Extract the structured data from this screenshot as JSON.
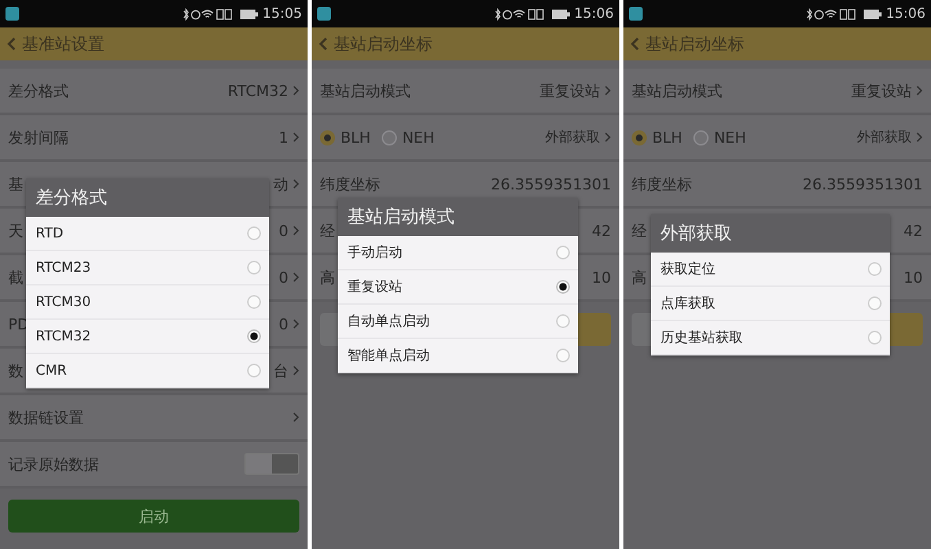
{
  "screens": [
    {
      "time": "15:05",
      "title": "基准站设置",
      "rows": [
        {
          "kind": "value",
          "label": "差分格式",
          "value": "RTCM32",
          "chevron": true
        },
        {
          "kind": "value",
          "label": "发射间隔",
          "value": "1",
          "chevron": true
        },
        {
          "kind": "value",
          "label": "基",
          "value": "动",
          "chevron": true
        },
        {
          "kind": "value",
          "label": "天",
          "value": "0",
          "chevron": true
        },
        {
          "kind": "value",
          "label": "截",
          "value": "0",
          "chevron": true
        },
        {
          "kind": "value",
          "label": "PD",
          "value": "0",
          "chevron": true
        },
        {
          "kind": "value",
          "label": "数",
          "value": "台",
          "chevron": true
        },
        {
          "kind": "value",
          "label": "数据链设置",
          "chevron": true
        },
        {
          "kind": "toggle",
          "label": "记录原始数据",
          "on": false
        },
        {
          "kind": "button",
          "label": "启动"
        }
      ],
      "dialog": {
        "title": "差分格式",
        "options": [
          {
            "label": "RTD",
            "selected": false
          },
          {
            "label": "RTCM23",
            "selected": false
          },
          {
            "label": "RTCM30",
            "selected": false
          },
          {
            "label": "RTCM32",
            "selected": true
          },
          {
            "label": "CMR",
            "selected": false
          }
        ]
      }
    },
    {
      "time": "15:06",
      "title": "基站启动坐标",
      "rows": [
        {
          "kind": "value",
          "label": "基站启动模式",
          "value": "重复设站",
          "chevron": true
        },
        {
          "kind": "radio",
          "options": [
            {
              "label": "BLH",
              "selected": true
            },
            {
              "label": "NEH",
              "selected": false
            }
          ],
          "value": "外部获取"
        },
        {
          "kind": "value",
          "label": "纬度坐标",
          "value": "26.3559351301"
        },
        {
          "kind": "value",
          "label": "经",
          "value": "42"
        },
        {
          "kind": "value",
          "label": "高",
          "value": "10"
        },
        {
          "kind": "button"
        }
      ],
      "dialog": {
        "title": "基站启动模式",
        "options": [
          {
            "label": "手动启动",
            "selected": false
          },
          {
            "label": "重复设站",
            "selected": true
          },
          {
            "label": "自动单点启动",
            "selected": false
          },
          {
            "label": "智能单点启动",
            "selected": false
          }
        ]
      }
    },
    {
      "time": "15:06",
      "title": "基站启动坐标",
      "rows": [
        {
          "kind": "value",
          "label": "基站启动模式",
          "value": "重复设站",
          "chevron": true
        },
        {
          "kind": "radio",
          "options": [
            {
              "label": "BLH",
              "selected": true
            },
            {
              "label": "NEH",
              "selected": false
            }
          ],
          "value": "外部获取"
        },
        {
          "kind": "value",
          "label": "纬度坐标",
          "value": "26.3559351301"
        },
        {
          "kind": "value",
          "label": "经",
          "value": "42"
        },
        {
          "kind": "value",
          "label": "高",
          "value": "10"
        },
        {
          "kind": "button"
        }
      ],
      "dialog": {
        "title": "外部获取",
        "options": [
          {
            "label": "获取定位",
            "selected": false
          },
          {
            "label": "点库获取",
            "selected": false
          },
          {
            "label": "历史基站获取",
            "selected": false
          }
        ]
      }
    }
  ]
}
